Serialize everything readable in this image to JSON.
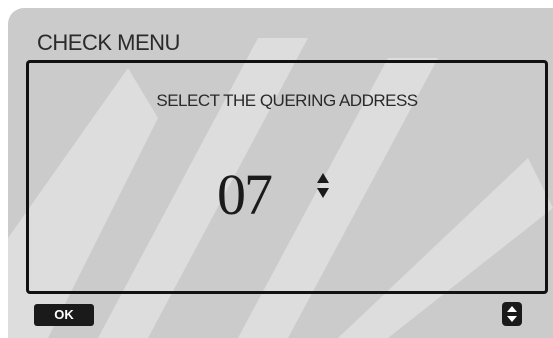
{
  "menu": {
    "title": "CHECK MENU"
  },
  "panel": {
    "prompt": "SELECT THE QUERING ADDRESS",
    "address_value": "07"
  },
  "softkeys": {
    "ok_label": "OK"
  },
  "icons": {
    "adjust": "up-down-arrows-icon",
    "scroll": "up-down-scroll-icon"
  }
}
